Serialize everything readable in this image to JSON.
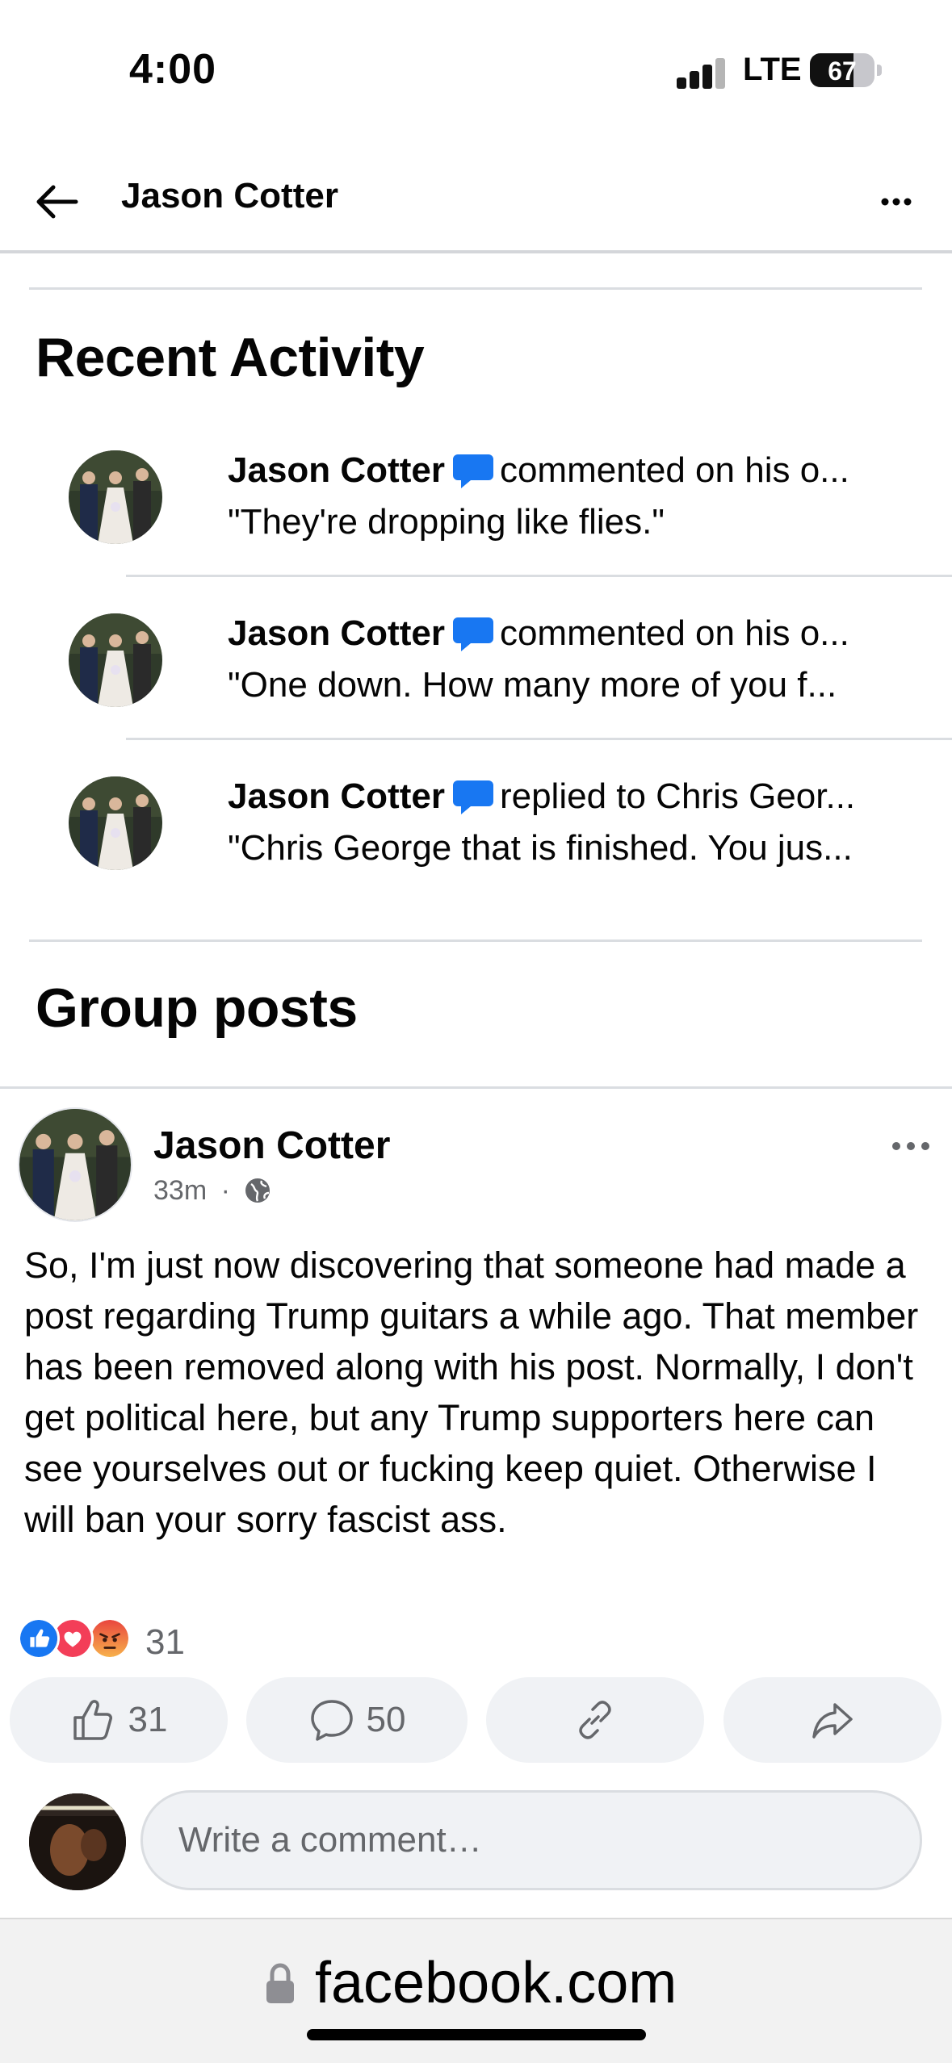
{
  "status_bar": {
    "time": "4:00",
    "network": "LTE",
    "battery": "67",
    "battery_level_percent": 67
  },
  "header": {
    "title": "Jason Cotter",
    "back_icon": "arrow-left-icon",
    "more_icon": "ellipsis-icon"
  },
  "recent_activity": {
    "heading": "Recent Activity",
    "items": [
      {
        "actor": "Jason Cotter",
        "action": "commented on his o...",
        "text": "\"They're dropping like flies.\""
      },
      {
        "actor": "Jason Cotter",
        "action": "commented on his o...",
        "text": "\"One down. How many more of you f..."
      },
      {
        "actor": "Jason Cotter",
        "action": "replied to Chris Geor...",
        "text": "\"Chris George that is finished. You jus..."
      }
    ]
  },
  "group_posts": {
    "heading": "Group posts",
    "post": {
      "author": "Jason Cotter",
      "time": "33m",
      "separator": "·",
      "privacy_icon": "globe-icon",
      "text": "So, I'm just now discovering that someone had made a post regarding Trump guitars a while ago. That member has been removed along with his post. Normally, I don't get political here, but any Trump supporters here can see yourselves out or fucking keep quiet. Otherwise I will ban your sorry fascist ass.",
      "reaction_count": "31",
      "reaction_icons": [
        "like-icon",
        "love-icon",
        "angry-icon"
      ],
      "actions": {
        "like_count": "31",
        "comment_count": "50"
      },
      "comment_placeholder": "Write a comment…"
    }
  },
  "browser": {
    "url": "facebook.com"
  },
  "colors": {
    "fb_blue": "#1877f2",
    "love_red": "#f33e58",
    "angry_orange": "#f7714b",
    "secondary_text": "#65676b",
    "button_bg": "#f0f2f5"
  }
}
